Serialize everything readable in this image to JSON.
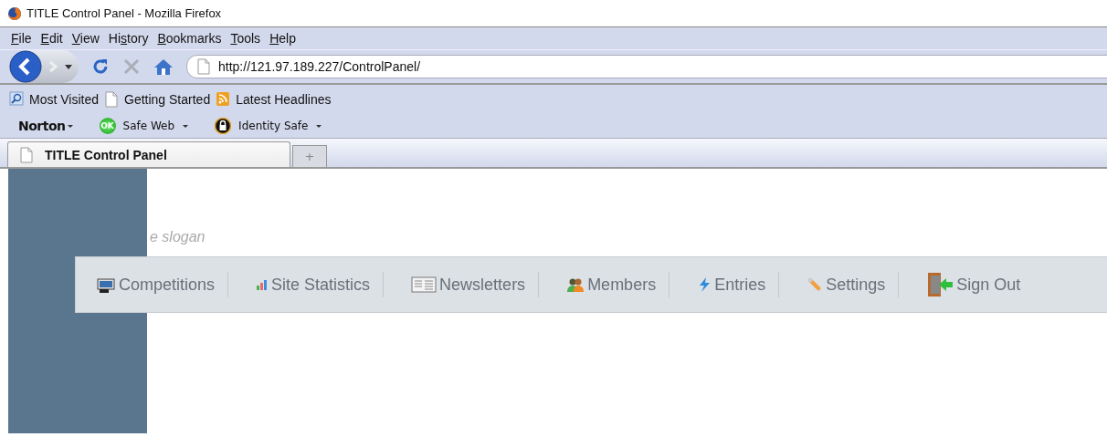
{
  "window": {
    "title": "TITLE Control Panel - Mozilla Firefox"
  },
  "menu": [
    {
      "key": "F",
      "rest": "ile"
    },
    {
      "key": "E",
      "rest": "dit"
    },
    {
      "key": "V",
      "rest": "iew"
    },
    {
      "before": "Hi",
      "key": "s",
      "rest": "tory"
    },
    {
      "key": "B",
      "rest": "ookmarks"
    },
    {
      "key": "T",
      "rest": "ools"
    },
    {
      "key": "H",
      "rest": "elp"
    }
  ],
  "address_bar": {
    "value": "http://121.97.189.227/ControlPanel/"
  },
  "bookmarks": [
    {
      "label": "Most Visited",
      "kind": "search"
    },
    {
      "label": "Getting Started",
      "kind": "page"
    },
    {
      "label": "Latest Headlines",
      "kind": "feed"
    }
  ],
  "norton_toolbar": {
    "brand": "Norton",
    "items": [
      {
        "label": "Safe Web",
        "kind": "ok",
        "ok": "OK"
      },
      {
        "label": "Identity Safe",
        "kind": "lock"
      }
    ]
  },
  "tabs": [
    {
      "label": "TITLE Control Panel",
      "selected": true
    },
    {
      "label": "+",
      "kind": "new",
      "selected": false
    }
  ],
  "page": {
    "slogan": "e slogan",
    "nav": [
      {
        "label": "Competitions",
        "kind": "competitions"
      },
      {
        "label": "Site Statistics",
        "kind": "stats"
      },
      {
        "label": "Newsletters",
        "kind": "newsletter"
      },
      {
        "label": "Members",
        "kind": "members"
      },
      {
        "label": "Entries",
        "kind": "entries"
      },
      {
        "label": "Settings",
        "kind": "settings"
      },
      {
        "label": "Sign Out",
        "kind": "signout"
      }
    ]
  }
}
